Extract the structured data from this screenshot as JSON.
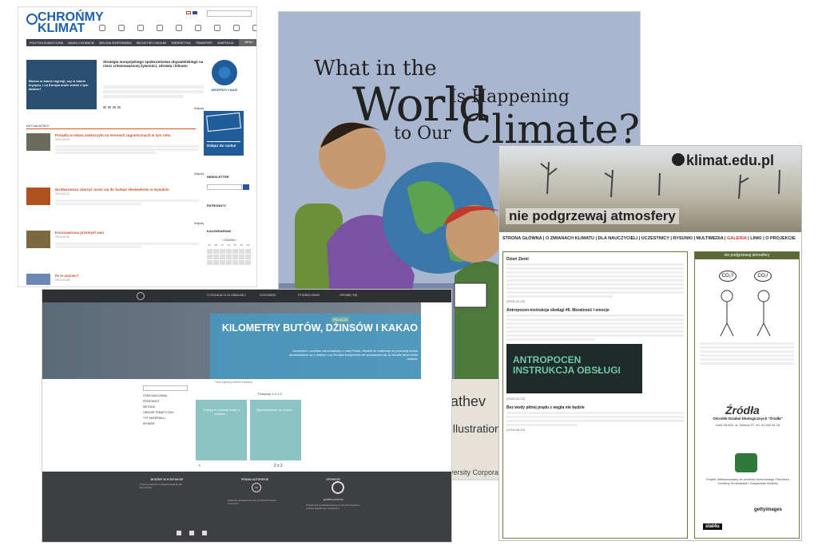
{
  "p1": {
    "logo_top": "CHROŃMY",
    "logo_bottom": "KLIMAT",
    "nav": [
      "POLITYKA KLIMATYCZNA",
      "NAUKA O KLIMACIE",
      "ZIELONA GOSPODARKA",
      "INICJATYWY LOKALNE",
      "ENERGETYKA",
      "TRANSPORT",
      "ADAPTACJA"
    ],
    "menu_label": "MENU",
    "hero_caption": "Biznes w stanie regresji, czy w stanie kryzysu, i co Europa może zrobić z tym fantem?",
    "hero_title": "Strategia europejskiego społeczeństwa obywatelskiego na rzecz zrównoważonej żywności, zdrowia i klimatu",
    "more": "Więcej",
    "section_title": "AKTUALNOŚCI",
    "news": [
      {
        "title": "Pożądla w mięsa zaskoczyło na terenach zagranicznych w tym roku",
        "date": "2019-04-15"
      },
      {
        "title": "Na Mazowszu zdarzyć może się do buduje ekwiwalentu w wysokim",
        "date": "2019-04-12"
      },
      {
        "title": "Koronawirusa przemysł sam",
        "date": "2019-04-09"
      },
      {
        "title": "Ile to waniec?",
        "date": "2019-04-05"
      }
    ],
    "wes_label": "WESPRZYJ NAS!",
    "join_label": "Dołącz do ruchu!",
    "newsletter": "NEWSLETTER",
    "patronaty": "PATRONATY",
    "kalendarium": "KALENDARIUM",
    "cal_month": "« 2019/05 »",
    "cal_days": [
      "Pn",
      "Wt",
      "Śr",
      "Cz",
      "Pt",
      "So",
      "Nd"
    ]
  },
  "p2": {
    "title_1": "What in the",
    "title_2": "World",
    "title_3": "Is Happening",
    "title_4": "to Our",
    "title_5": "Climate?",
    "author_fragment": "ca Hathev",
    "illustrations_fragment": "Illustrations",
    "publisher_fragment": "versity Corporation f"
  },
  "p3": {
    "brand": "klimat.edu.pl",
    "slogan": "nie podgrzewaj atmosfery",
    "menu_1": "STRONA GŁÓWNA | O ZMIANACH KLIMATU | DLA NAUCZYCIELI | UCZESTNICY | RYSUNKI | MULTIMEDIA | ",
    "menu_active": "GALERIA",
    "menu_2": " | LINKI | O PROJEKCIE",
    "h1": "Dzień Ziemi",
    "d1": "(2020-04-22)",
    "h2": "Antropocen-instrukcja obsługi #6. Moralność i emocje",
    "antro_1": "ANTROPOCEN",
    "antro_2": "INSTRUKCJA OBSŁUGI",
    "d2": "(2020-02-03)",
    "h3": "Bez wody pitnej prądu z węgla nie będzie",
    "d3": "(2019-08-10)",
    "side_header": "nie podgrzewaj atmosfery",
    "bubble_1": "CO₂?",
    "bubble_2": "CO₂!",
    "zrodla": "Źródła",
    "zrodla_sub": "Ośrodek Działań Ekologicznych \"Źródła\"",
    "zrodla_addr": "Łódź 90-602, ul. Zielona 27, tel. 42 632 81 18",
    "proj_text": "Projekt dofinansowany ze środków Narodowego Funduszu Ochrony Środowiska i Gospodarki Wodnej",
    "getty": "gettyimages",
    "stat4u": "stat4u"
  },
  "p4": {
    "nav": [
      "O EDUKACJI GLOBALNEJ",
      "SCHOWEK",
      "PODRĘCZNIKI",
      "ZROBIĘ SIĘ"
    ],
    "badge": "RELACJA",
    "hero_title": "KILOMETRY BUTÓW, DŻINSÓW I KAKAO",
    "hero_desc": "Uczennice i uczniów zakochaliśmy z całej Polski. Myśleli że materiały do produkcji butów sprowadzane są z daleka i czy Europa kompletnie nie sprowadza się do tematu łańcuchów dostaw.",
    "crumb": "Twój wybrany ścieżki edukacji",
    "pager": "Pokazuje 1-2 z 2",
    "side_items": [
      "STAN NAUCZANIA",
      "PRZEDMIOT",
      "METODA",
      "OBSZAR TEMATYCZNY",
      "TYP MATERIAŁU",
      "WYMIAR"
    ],
    "card_1": "Dostęp do czystej wody a zmiana…",
    "card_2": "Wprowadzenie do zmian…",
    "pages": "2 z 2",
    "arrow": "‹",
    "f_col1_h": "BUDŹMY W KONTAKCIE",
    "f_col1_t": "Strona prowadzi Fundacja Edukacja dla Demokracji",
    "f_col2_h": "PRAWA AUTORSKIE",
    "f_col2_t": "Materiały udostępnione są na licencji Creative Commons",
    "f_col3_h": "SPONSOR",
    "f_col3_t": "Projekt jest współfinansowany w ramach programu polskiej współpracy rozwojowej",
    "cc": "cc",
    "pp_label": "polska pomoc"
  }
}
